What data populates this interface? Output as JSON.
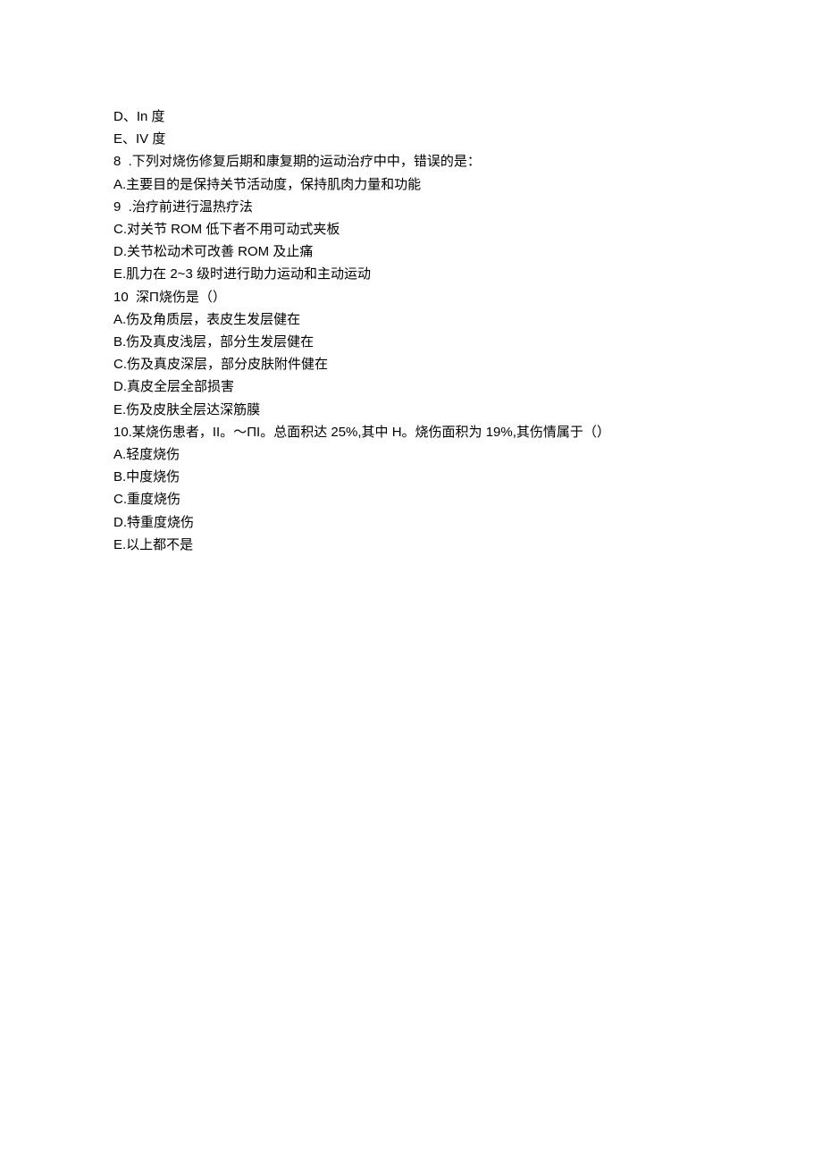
{
  "lines": [
    "D、In 度",
    "E、IV 度",
    "8  .下列对烧伤修复后期和康复期的运动治疗中中，错误的是：",
    "A.主要目的是保持关节活动度，保持肌肉力量和功能",
    "9  .治疗前进行温热疗法",
    "C.对关节 ROM 低下者不用可动式夹板",
    "D.关节松动术可改善 ROM 及止痛",
    "E.肌力在 2~3 级时进行助力运动和主动运动",
    "10  深Π烧伤是（）",
    "A.伤及角质层，表皮生发层健在",
    "B.伤及真皮浅层，部分生发层健在",
    "C.伤及真皮深层，部分皮肤附件健在",
    "D.真皮全层全部损害",
    "E.伤及皮肤全层达深筋膜",
    "10.某烧伤患者，II。～ΠI。总面积达 25%,其中 H。烧伤面积为 19%,其伤情属于（）",
    "A.轻度烧伤",
    "B.中度烧伤",
    "C.重度烧伤",
    "D.特重度烧伤",
    "E.以上都不是"
  ]
}
